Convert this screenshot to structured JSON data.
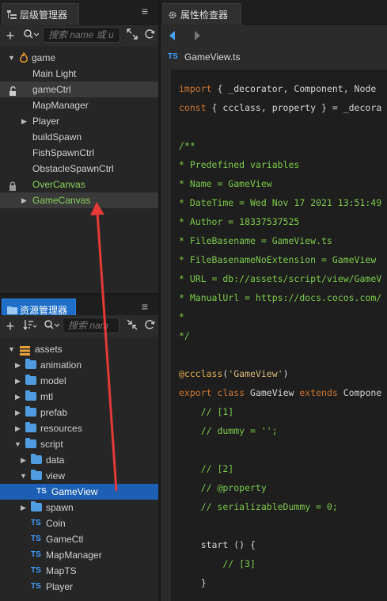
{
  "hierarchy": {
    "tab_label": "层级管理器",
    "search_placeholder": "搜索 name 或 u",
    "items": [
      {
        "label": "game",
        "color": "#d0d0d0"
      },
      {
        "label": "Main Light"
      },
      {
        "label": "gameCtrl"
      },
      {
        "label": "MapManager"
      },
      {
        "label": "Player"
      },
      {
        "label": "buildSpawn"
      },
      {
        "label": "FishSpawnCtrl"
      },
      {
        "label": "ObstacleSpawnCtrl"
      },
      {
        "label": "OverCanvas",
        "color": "#8bd15e"
      },
      {
        "label": "GameCanvas",
        "color": "#8bd15e"
      }
    ]
  },
  "assets": {
    "tab_label": "资源管理器",
    "search_placeholder": "搜索 nam",
    "items": [
      {
        "label": "assets"
      },
      {
        "label": "animation"
      },
      {
        "label": "model"
      },
      {
        "label": "mtl"
      },
      {
        "label": "prefab"
      },
      {
        "label": "resources"
      },
      {
        "label": "script"
      },
      {
        "label": "data"
      },
      {
        "label": "view"
      },
      {
        "label": "GameView",
        "type": "TS"
      },
      {
        "label": "spawn"
      },
      {
        "label": "Coin",
        "type": "TS"
      },
      {
        "label": "GameCtl",
        "type": "TS"
      },
      {
        "label": "MapManager",
        "type": "TS"
      },
      {
        "label": "MapTS",
        "type": "TS"
      },
      {
        "label": "Player",
        "type": "TS"
      }
    ]
  },
  "inspector": {
    "tab_label": "属性检查器",
    "file_badge": "TS",
    "file_name": "GameView.ts",
    "code_lines": [
      "import { _decorator, Component, Node",
      "const { ccclass, property } = _decora",
      "",
      "/**",
      "* Predefined variables",
      "* Name = GameView",
      "* DateTime = Wed Nov 17 2021 13:51:49",
      "* Author = 18337537525",
      "* FileBasename = GameView.ts",
      "* FileBasenameNoExtension = GameView",
      "* URL = db://assets/script/view/GameV",
      "* ManualUrl = https://docs.cocos.com/",
      "*",
      "*/",
      "",
      "@ccclass('GameView')",
      "export class GameView extends Compone",
      "    // [1]",
      "    // dummy = '';",
      "",
      "    // [2]",
      "    // @property",
      "    // serializableDummy = 0;",
      "",
      "    start () {",
      "        // [3]",
      "    }"
    ]
  },
  "colors": {
    "accent": "#1f6fc8",
    "selection": "#1d5fb4",
    "node_green": "#8bd15e",
    "arrow_red": "#e53935",
    "comment": "#7ec94a",
    "keyword": "#e2c08d"
  }
}
